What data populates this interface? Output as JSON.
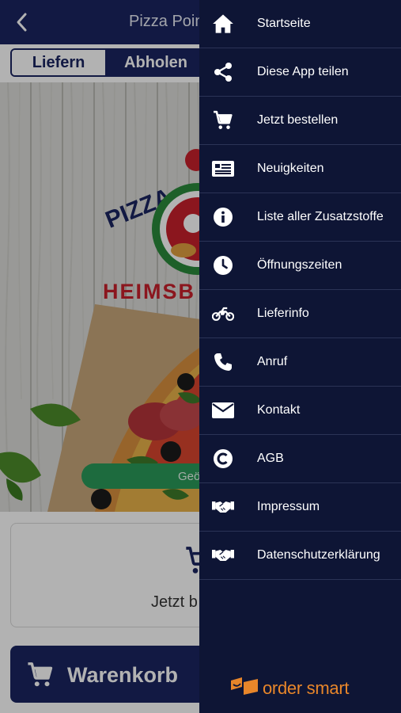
{
  "app_bar": {
    "title": "Pizza Point",
    "back_icon": "chevron-left-icon"
  },
  "order_mode": {
    "delivery_label": "Liefern",
    "pickup_label": "Abholen",
    "selected": "pickup"
  },
  "hero": {
    "logo_word": "PIZZA",
    "logo_city": "HEIMSB",
    "badge_text": "Geö"
  },
  "order_card": {
    "icon": "cart-icon",
    "label": "Jetzt b"
  },
  "cart_button": {
    "icon": "cart-icon",
    "label": "Warenkorb"
  },
  "drawer": {
    "items": [
      {
        "icon": "home-icon",
        "label": "Startseite"
      },
      {
        "icon": "share-icon",
        "label": "Diese App teilen"
      },
      {
        "icon": "cart-icon",
        "label": "Jetzt bestellen"
      },
      {
        "icon": "newspaper-icon",
        "label": "Neuigkeiten"
      },
      {
        "icon": "info-icon",
        "label": "Liste aller Zusatzstoffe"
      },
      {
        "icon": "clock-icon",
        "label": "Öffnungszeiten"
      },
      {
        "icon": "motorcycle-icon",
        "label": "Lieferinfo"
      },
      {
        "icon": "phone-icon",
        "label": "Anruf"
      },
      {
        "icon": "envelope-icon",
        "label": "Kontakt"
      },
      {
        "icon": "copyright-icon",
        "label": "AGB"
      },
      {
        "icon": "handshake-icon",
        "label": "Impressum"
      },
      {
        "icon": "handshake-icon",
        "label": "Datenschutzerklärung"
      }
    ],
    "brand": {
      "label": "order smart",
      "icon": "order-smart-logo-icon"
    }
  },
  "colors": {
    "navy": "#1a2560",
    "drawer_bg": "#0e1535",
    "accent_orange": "#e8862a",
    "badge_green": "#2a9a5a"
  }
}
